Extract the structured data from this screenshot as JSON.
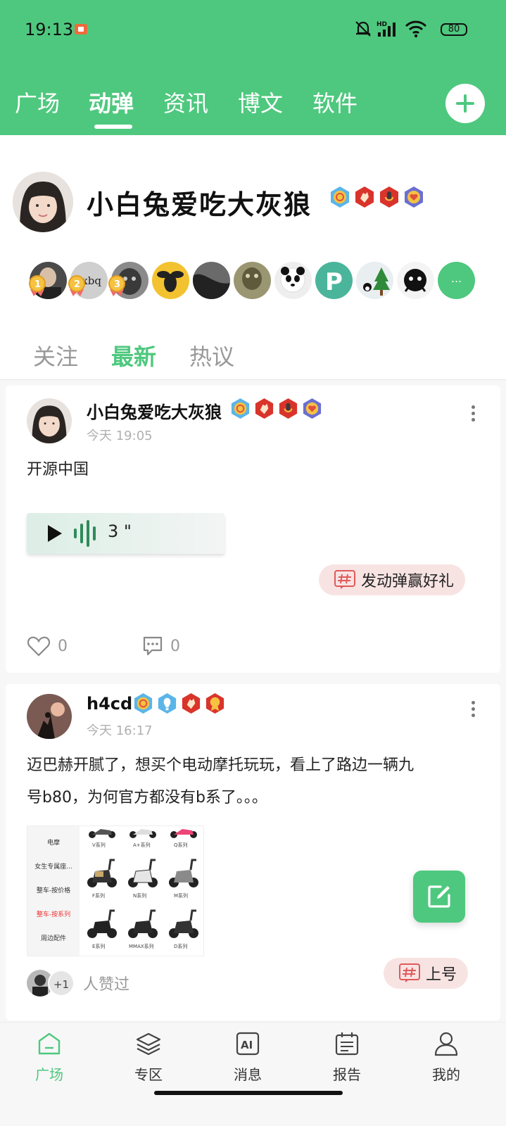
{
  "status_bar": {
    "time": "19:13",
    "battery": "80"
  },
  "top_tabs": [
    {
      "label": "广场",
      "active": false
    },
    {
      "label": "动弹",
      "active": true
    },
    {
      "label": "资讯",
      "active": false
    },
    {
      "label": "博文",
      "active": false
    },
    {
      "label": "软件",
      "active": false
    }
  ],
  "profile": {
    "name": "小白兔爱吃大灰狼",
    "more_label": "..."
  },
  "sub_tabs": [
    {
      "label": "关注",
      "active": false
    },
    {
      "label": "最新",
      "active": true
    },
    {
      "label": "热议",
      "active": false
    }
  ],
  "posts": [
    {
      "author": "小白兔爱吃大灰狼",
      "time": "今天 19:05",
      "text": "开源中国",
      "voice_length": "3 \"",
      "topic": "发动弹赢好礼",
      "likes": "0",
      "comments": "0"
    },
    {
      "author": "h4cd",
      "time": "今天 16:17",
      "text_line1": "迈巴赫开腻了，想买个电动摩托玩玩，看上了路边一辆九",
      "text_line2": "号b80，为何官方都没有b系了。。。",
      "topic": "上号",
      "liker_count": "+1",
      "likers_text": "人赞过",
      "image": {
        "menu": [
          "电摩",
          "女生专属座...",
          "整车-按价格",
          "整车-按系列",
          "周边配件"
        ],
        "labels": [
          "V系列",
          "A+系列",
          "Q系列",
          "F系列",
          "N系列",
          "M系列",
          "E系列",
          "MMAX系列",
          "D系列"
        ]
      }
    }
  ],
  "bottom_nav": [
    {
      "label": "广场",
      "icon": "home-icon",
      "active": true
    },
    {
      "label": "专区",
      "icon": "layers-icon",
      "active": false
    },
    {
      "label": "消息",
      "icon": "ai-message-icon",
      "active": false
    },
    {
      "label": "报告",
      "icon": "report-icon",
      "active": false
    },
    {
      "label": "我的",
      "icon": "person-icon",
      "active": false
    }
  ],
  "colors": {
    "brand": "#4ec87e",
    "tag_bg": "#f8e3e3",
    "muted": "#999999"
  }
}
